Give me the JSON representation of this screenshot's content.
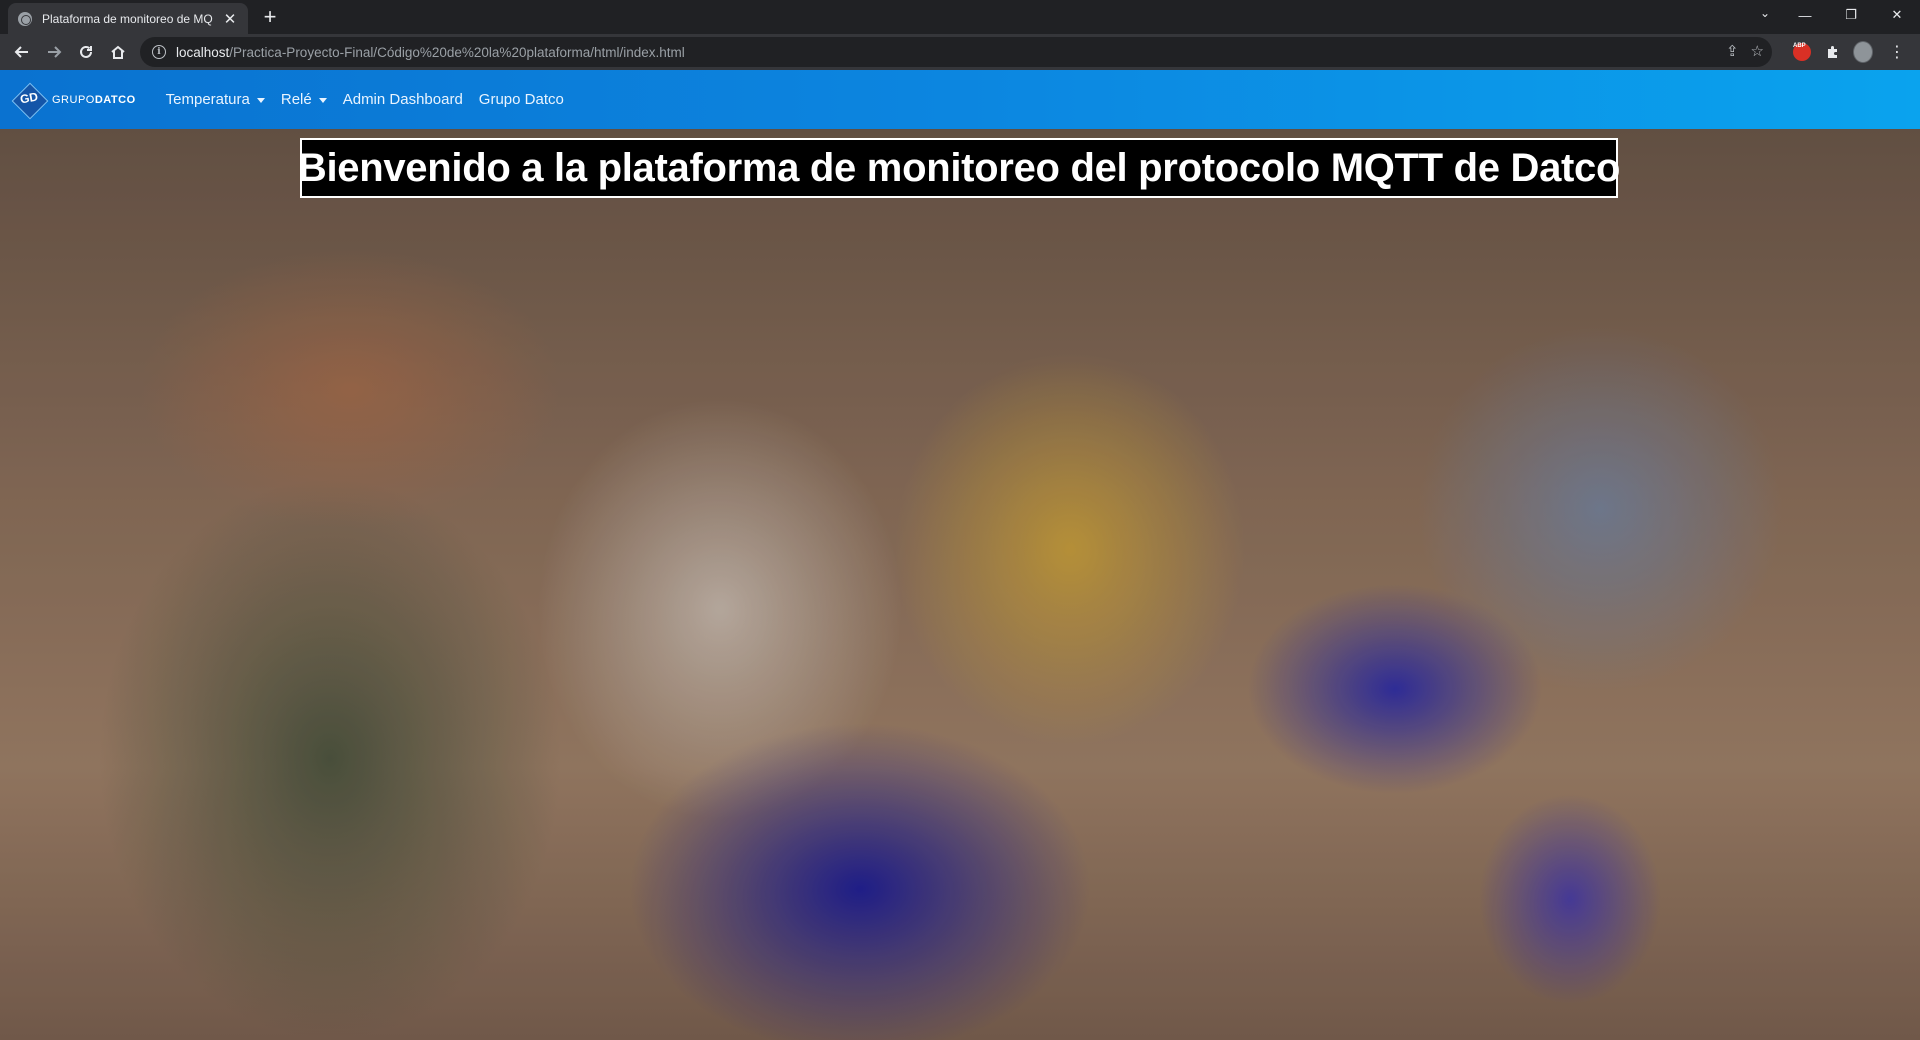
{
  "browser": {
    "tab_title": "Plataforma de monitoreo de MQ",
    "url_host": "localhost",
    "url_path": "/Practica-Proyecto-Final/Código%20de%20la%20plataforma/html/index.html"
  },
  "navbar": {
    "brand_prefix": "GRUPO",
    "brand_suffix": "DATCO",
    "brand_mark": "GD",
    "items": [
      {
        "label": "Temperatura",
        "dropdown": true
      },
      {
        "label": "Relé",
        "dropdown": true
      },
      {
        "label": "Admin Dashboard",
        "dropdown": false
      },
      {
        "label": "Grupo Datco",
        "dropdown": false
      }
    ]
  },
  "hero": {
    "headline": "Bienvenido a la plataforma de monitoreo del protocolo MQTT de Datco"
  },
  "colors": {
    "navbar_start": "#0a72d0",
    "navbar_end": "#0aa3ee",
    "headline_bg": "#000000",
    "headline_text": "#ffffff"
  }
}
